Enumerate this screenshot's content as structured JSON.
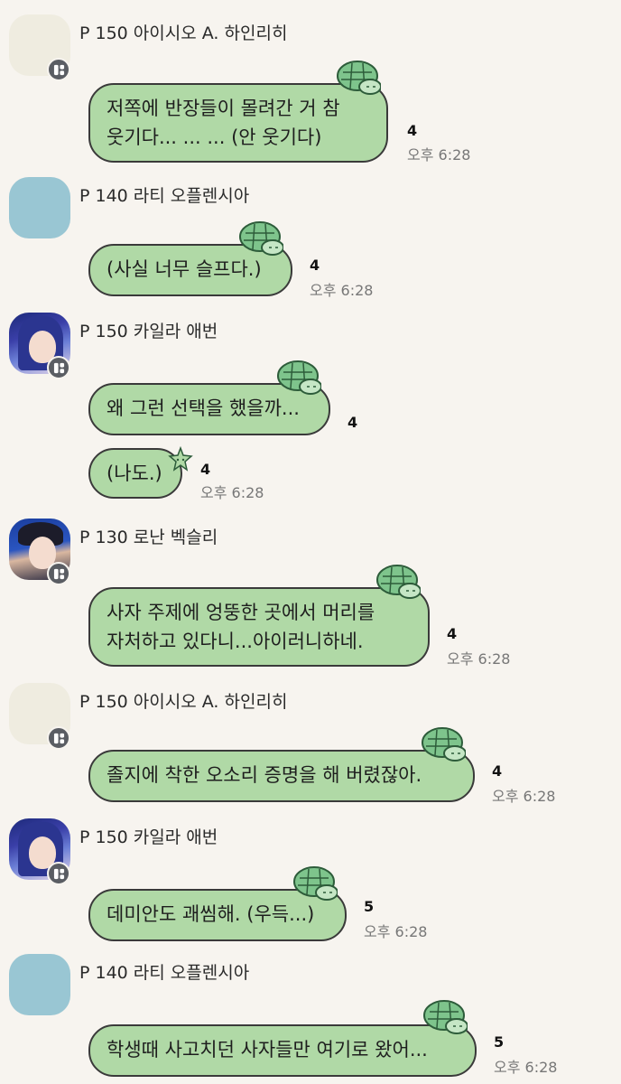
{
  "messages": [
    {
      "sender": "P 150 아이시오 A. 하인리히",
      "avatar": "cream-avatar",
      "lines": [
        "저쪽에 반장들이 몰려간 거 참",
        "웃기다... ... ... (안 웃기다)"
      ],
      "unread": "4",
      "time": "오후 6:28"
    },
    {
      "sender": "P 140 라티 오플렌시아",
      "avatar": "blue-avatar",
      "lines": [
        "(사실 너무 슬프다.)"
      ],
      "unread": "4",
      "time": "오후 6:28"
    },
    {
      "sender": "P 150 카일라 애번",
      "avatar": "girl-avatar",
      "lines": [
        "왜 그런 선택을 했을까..."
      ],
      "unread": "4",
      "second_lines": [
        "(나도.)"
      ],
      "second_unread": "4",
      "time": "오후 6:28"
    },
    {
      "sender": "P 130 로난 벡슬리",
      "avatar": "boy-avatar",
      "lines": [
        "사자 주제에 엉뚱한 곳에서 머리를",
        "자처하고 있다니...아이러니하네."
      ],
      "unread": "4",
      "time": "오후 6:28"
    },
    {
      "sender": "P 150 아이시오 A. 하인리히",
      "avatar": "cream-avatar",
      "lines": [
        "졸지에 착한 오소리 증명을 해 버렸잖아."
      ],
      "unread": "4",
      "time": "오후 6:28"
    },
    {
      "sender": "P 150 카일라 애번",
      "avatar": "girl-avatar",
      "lines": [
        "데미안도 괘씸해. (우득...)"
      ],
      "unread": "5",
      "time": "오후 6:28"
    },
    {
      "sender": "P 140 라티 오플렌시아",
      "avatar": "blue-avatar",
      "lines": [
        "학생때 사고치던 사자들만 여기로 왔어..."
      ],
      "unread": "5",
      "time": "오후 6:28"
    }
  ],
  "colors": {
    "background": "#f7f4ef",
    "bubble": "#b0d9a6",
    "bubble_border": "#3a3a3a",
    "time_text": "#777777"
  }
}
